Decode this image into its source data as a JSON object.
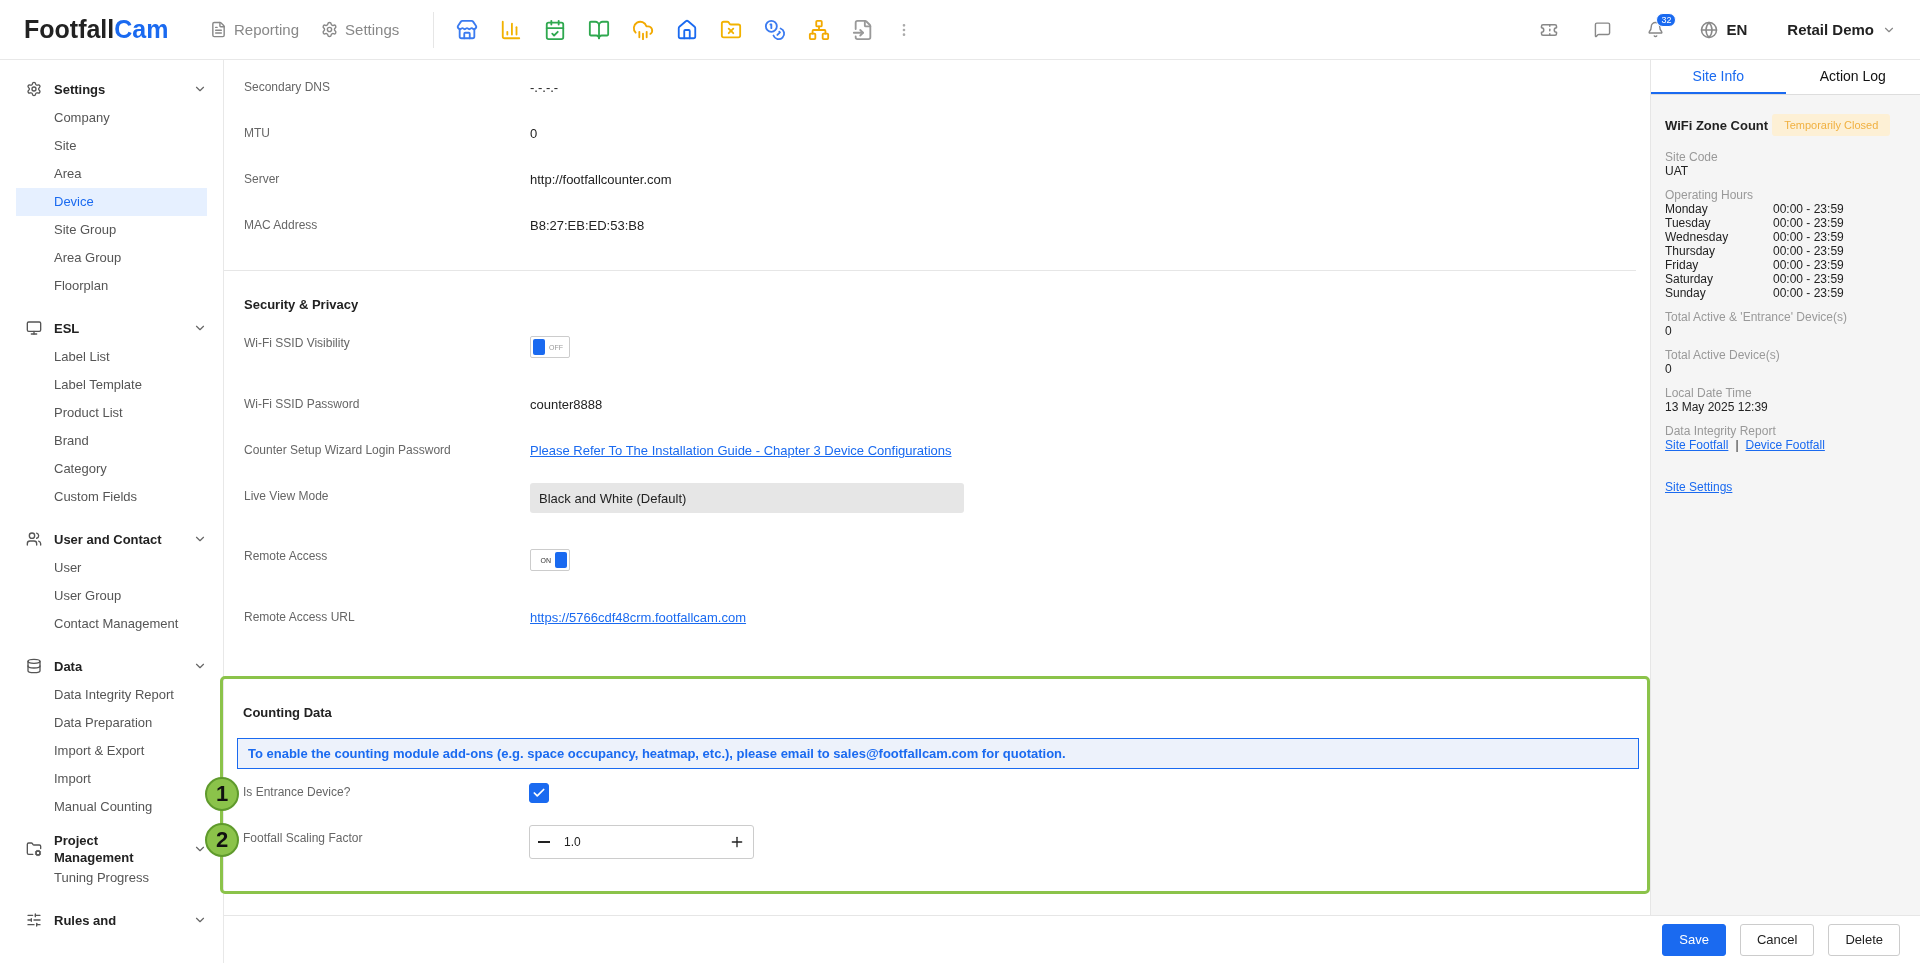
{
  "topbar": {
    "logo": [
      "Footfall",
      "Cam"
    ],
    "nav": [
      {
        "label": "Reporting",
        "kind": "report"
      },
      {
        "label": "Settings",
        "kind": "gear"
      }
    ],
    "notifications": "32",
    "language": "EN",
    "account": "Retail Demo"
  },
  "sidebar": [
    {
      "title": "Settings",
      "expanded": true,
      "items": [
        {
          "label": "Company",
          "selected": false
        },
        {
          "label": "Site",
          "selected": false
        },
        {
          "label": "Area",
          "selected": false
        },
        {
          "label": "Device",
          "selected": true
        },
        {
          "label": "Site Group",
          "selected": false
        },
        {
          "label": "Area Group",
          "selected": false
        },
        {
          "label": "Floorplan",
          "selected": false
        }
      ]
    },
    {
      "title": "ESL",
      "expanded": true,
      "items": [
        {
          "label": "Label List",
          "selected": false
        },
        {
          "label": "Label Template",
          "selected": false
        },
        {
          "label": "Product List",
          "selected": false
        },
        {
          "label": "Brand",
          "selected": false
        },
        {
          "label": "Category",
          "selected": false
        },
        {
          "label": "Custom Fields",
          "selected": false
        }
      ]
    },
    {
      "title": "User and Contact",
      "expanded": true,
      "items": [
        {
          "label": "User",
          "selected": false
        },
        {
          "label": "User Group",
          "selected": false
        },
        {
          "label": "Contact Management",
          "selected": false
        }
      ]
    },
    {
      "title": "Data",
      "expanded": true,
      "items": [
        {
          "label": "Data Integrity Report",
          "selected": false
        },
        {
          "label": "Data Preparation",
          "selected": false
        },
        {
          "label": "Import & Export",
          "selected": false
        },
        {
          "label": "Import",
          "selected": false
        },
        {
          "label": "Manual Counting",
          "selected": false
        }
      ]
    },
    {
      "title": "Project Management",
      "expanded": true,
      "items": [
        {
          "label": "Tuning Progress",
          "selected": false
        }
      ]
    },
    {
      "title": "Rules and",
      "expanded": true
    }
  ],
  "network_fields": [
    {
      "label": "Secondary DNS",
      "kind": "text",
      "value": "-.-.-.-"
    },
    {
      "label": "MTU",
      "kind": "text",
      "value": "0"
    },
    {
      "label": "Server",
      "kind": "text",
      "value": "http://footfallcounter.com"
    },
    {
      "label": "MAC Address",
      "kind": "text",
      "value": "B8:27:EB:ED:53:B8"
    }
  ],
  "security": {
    "title": "Security & Privacy",
    "fields": [
      {
        "label": "Wi-Fi SSID Visibility",
        "kind": "switch",
        "on": false,
        "value": "OFF"
      },
      {
        "label": "Wi-Fi SSID Password",
        "kind": "text",
        "value": "counter8888"
      },
      {
        "label": "Counter Setup Wizard Login Password",
        "kind": "link",
        "value": "Please Refer To The Installation Guide - Chapter 3 Device Configurations"
      },
      {
        "label": "Live View Mode",
        "kind": "select",
        "value": "Black and White (Default)"
      },
      {
        "label": "Remote Access",
        "kind": "switch",
        "on": true,
        "value": "ON"
      },
      {
        "label": "Remote Access URL",
        "kind": "link",
        "value": "https://5766cdf48crm.footfallcam.com"
      }
    ]
  },
  "counting": {
    "title": "Counting Data",
    "notice": "To enable the counting module add-ons (e.g. space occupancy, heatmap, etc.), please email to sales@footfallcam.com for quotation.",
    "fields": [
      {
        "label": "Is Entrance Device?",
        "kind": "checkbox",
        "checked": true,
        "marker": "1"
      },
      {
        "label": "Footfall Scaling Factor",
        "kind": "stepper",
        "value": "1.0",
        "marker": "2"
      }
    ]
  },
  "panel": {
    "tabs": [
      {
        "label": "Site Info",
        "selected": true
      },
      {
        "label": "Action Log",
        "selected": false
      }
    ],
    "site_name": "WiFi Zone Count",
    "status": "Temporarily Closed",
    "site_code": {
      "label": "Site Code",
      "value": "UAT"
    },
    "hours_label": "Operating Hours",
    "hours": [
      {
        "day": "Monday",
        "time": "00:00 - 23:59"
      },
      {
        "day": "Tuesday",
        "time": "00:00 - 23:59"
      },
      {
        "day": "Wednesday",
        "time": "00:00 - 23:59"
      },
      {
        "day": "Thursday",
        "time": "00:00 - 23:59"
      },
      {
        "day": "Friday",
        "time": "00:00 - 23:59"
      },
      {
        "day": "Saturday",
        "time": "00:00 - 23:59"
      },
      {
        "day": "Sunday",
        "time": "00:00 - 23:59"
      }
    ],
    "stats": [
      {
        "label": "Total Active & 'Entrance' Device(s)",
        "value": "0"
      },
      {
        "label": "Total Active Device(s)",
        "value": "0"
      },
      {
        "label": "Local Date Time",
        "value": "13 May 2025 12:39"
      }
    ],
    "report_label": "Data Integrity Report",
    "report_links": [
      "Site Footfall",
      "Device Footfall"
    ],
    "separator": "|",
    "settings_link": "Site Settings"
  },
  "footer": {
    "buttons": [
      {
        "label": "Save",
        "kind": "primary"
      },
      {
        "label": "Cancel",
        "kind": "default"
      },
      {
        "label": "Delete",
        "kind": "default"
      }
    ]
  }
}
